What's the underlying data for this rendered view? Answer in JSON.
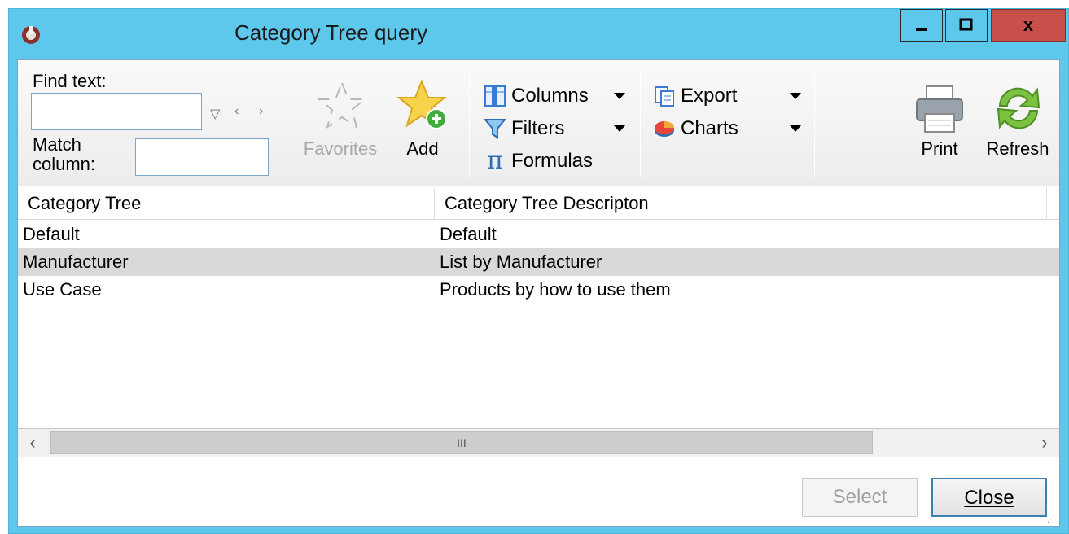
{
  "window": {
    "title": "Category Tree query",
    "close_glyph": "x"
  },
  "toolbar": {
    "find_text_label": "Find text:",
    "match_column_label_1": "Match",
    "match_column_label_2": "column:",
    "find_text_value": "",
    "match_column_value": "",
    "favorites_label": "Favorites",
    "add_label": "Add",
    "columns_label": "Columns",
    "filters_label": "Filters",
    "formulas_label": "Formulas",
    "export_label": "Export",
    "charts_label": "Charts",
    "print_label": "Print",
    "refresh_label": "Refresh"
  },
  "grid": {
    "columns": [
      "Category Tree",
      "Category Tree Descripton"
    ],
    "rows": [
      {
        "tree": "Default",
        "desc": "Default",
        "selected": false
      },
      {
        "tree": "Manufacturer",
        "desc": "List by Manufacturer",
        "selected": true
      },
      {
        "tree": "Use Case",
        "desc": "Products by how to use them",
        "selected": false
      }
    ],
    "scroll_thumb_glyph": "III"
  },
  "footer": {
    "select_label": "Select",
    "close_label": "Close"
  },
  "colors": {
    "window_frame": "#5ec8ec",
    "close_button": "#c7504a",
    "selected_row": "#d9d9d9"
  },
  "icons": {
    "app": "app-icon",
    "favorites": "star-outline-icon",
    "add": "star-add-icon",
    "columns": "columns-icon",
    "filters": "funnel-icon",
    "formulas": "pi-icon",
    "export": "export-icon",
    "charts": "pie-chart-icon",
    "print": "printer-icon",
    "refresh": "refresh-icon"
  }
}
